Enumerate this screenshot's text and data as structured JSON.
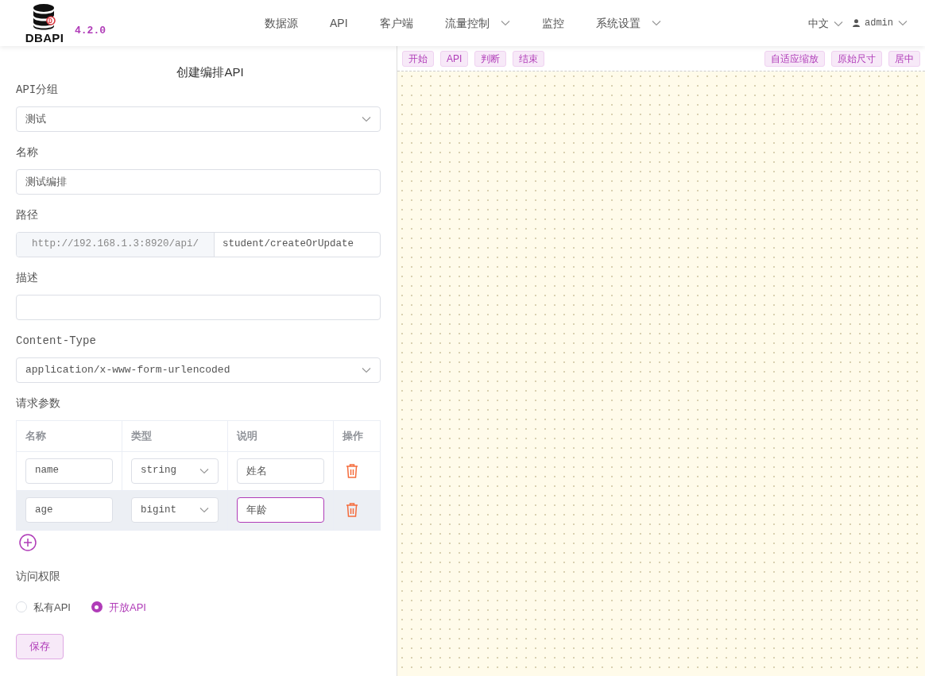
{
  "header": {
    "logo_text": "DBAPI",
    "version": "4.2.0",
    "nav": [
      {
        "label": "数据源",
        "dropdown": false
      },
      {
        "label": "API",
        "dropdown": false
      },
      {
        "label": "客户端",
        "dropdown": false
      },
      {
        "label": "流量控制",
        "dropdown": true
      },
      {
        "label": "监控",
        "dropdown": false
      },
      {
        "label": "系统设置",
        "dropdown": true
      }
    ],
    "language": "中文",
    "user": "admin"
  },
  "form": {
    "title": "创建编排API",
    "group": {
      "label": "API分组",
      "value": "测试"
    },
    "name": {
      "label": "名称",
      "value": "测试编排"
    },
    "path": {
      "label": "路径",
      "prefix": "http://192.168.1.3:8920/api/",
      "value": "student/createOrUpdate"
    },
    "description": {
      "label": "描述"
    },
    "content_type": {
      "label": "Content-Type",
      "value": "application/x-www-form-urlencoded"
    },
    "params": {
      "label": "请求参数",
      "columns": [
        "名称",
        "类型",
        "说明",
        "操作"
      ],
      "rows": [
        {
          "name": "name",
          "type": "string",
          "note": "姓名",
          "highlighted": false,
          "note_focused": false
        },
        {
          "name": "age",
          "type": "bigint",
          "note": "年龄",
          "highlighted": true,
          "note_focused": true
        }
      ]
    },
    "access": {
      "label": "访问权限",
      "options": [
        {
          "label": "私有API",
          "selected": false
        },
        {
          "label": "开放API",
          "selected": true
        }
      ]
    },
    "save": "保存"
  },
  "canvas": {
    "left_tools": [
      "开始",
      "API",
      "判断",
      "结束"
    ],
    "right_tools": [
      "自适应缩放",
      "原始尺寸",
      "居中"
    ]
  }
}
